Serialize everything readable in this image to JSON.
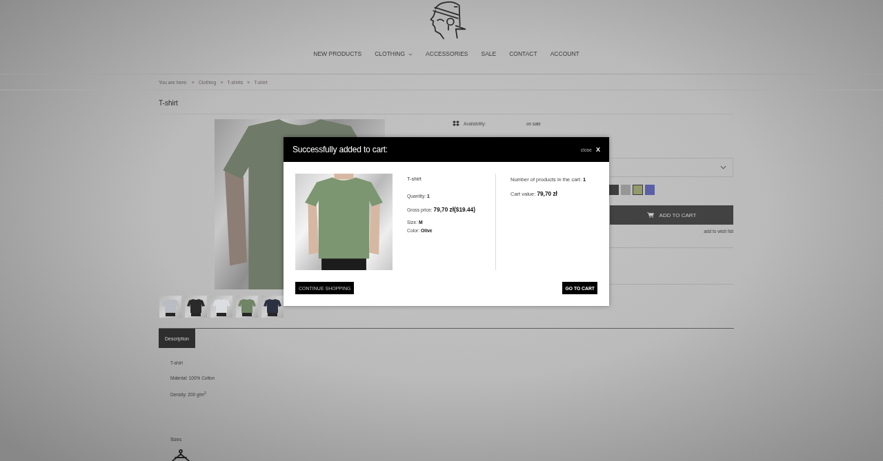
{
  "header": {
    "nav": [
      {
        "label": "NEW PRODUCTS",
        "dropdown": false
      },
      {
        "label": "CLOTHING",
        "dropdown": true
      },
      {
        "label": "ACCESSORIES",
        "dropdown": false
      },
      {
        "label": "SALE",
        "dropdown": false
      },
      {
        "label": "CONTACT",
        "dropdown": false
      },
      {
        "label": "ACCOUNT",
        "dropdown": false
      }
    ]
  },
  "breadcrumb": {
    "prefix": "You are here:",
    "items": [
      {
        "separator": "»",
        "label": "Clothing"
      },
      {
        "separator": "»",
        "label": "T-shirts"
      },
      {
        "separator": "»",
        "label": "T-shirt"
      }
    ]
  },
  "product": {
    "title": "T-shirt",
    "thumbnails": [
      {
        "color": "#b9bcc2"
      },
      {
        "color": "#2a2a2a"
      },
      {
        "color": "#dcdde0"
      },
      {
        "color": "#6f8565"
      },
      {
        "color": "#2b3140"
      }
    ],
    "availability": {
      "label": "Availability:",
      "value": "on sale"
    },
    "color_swatches": [
      {
        "color": "#3d3d3d",
        "selected": false
      },
      {
        "color": "#969696",
        "selected": false
      },
      {
        "color": "#939a6b",
        "selected": true
      },
      {
        "color": "#5a5fa6",
        "selected": false
      }
    ],
    "add_to_cart": "ADD TO CART",
    "wish_list": "add to wish list"
  },
  "tabs": [
    {
      "label": "Description",
      "selected": true
    }
  ],
  "description": {
    "lines": [
      "T-shirt",
      "Material: 100% Cotton",
      "Density: 200 g/m$^{2}$"
    ],
    "sizes_heading": "Sizes"
  },
  "modal": {
    "title": "Successfully added to cart:",
    "close": {
      "label": "close",
      "glyph": "X"
    },
    "product": {
      "name": "T-shirt",
      "detail_groups": [
        [
          {
            "label": "Quantity:",
            "value": "1",
            "kind": "plain"
          }
        ],
        [
          {
            "label": "Gross price:",
            "value": "79,70 zł($19.44)",
            "kind": "price"
          }
        ],
        [
          {
            "label": "Size:",
            "value": "M",
            "kind": "plain"
          },
          {
            "label": "Color:",
            "value": "Olive",
            "kind": "plain"
          }
        ]
      ]
    },
    "summary": [
      {
        "label": "Number of products in the cart:",
        "value": "1",
        "kind": "plain"
      },
      {
        "label": "Cart value:",
        "value": "79,70 zł",
        "kind": "price"
      }
    ],
    "buttons": {
      "continue": "CONTINUE SHOPPING",
      "checkout": "GO TO CART"
    }
  }
}
